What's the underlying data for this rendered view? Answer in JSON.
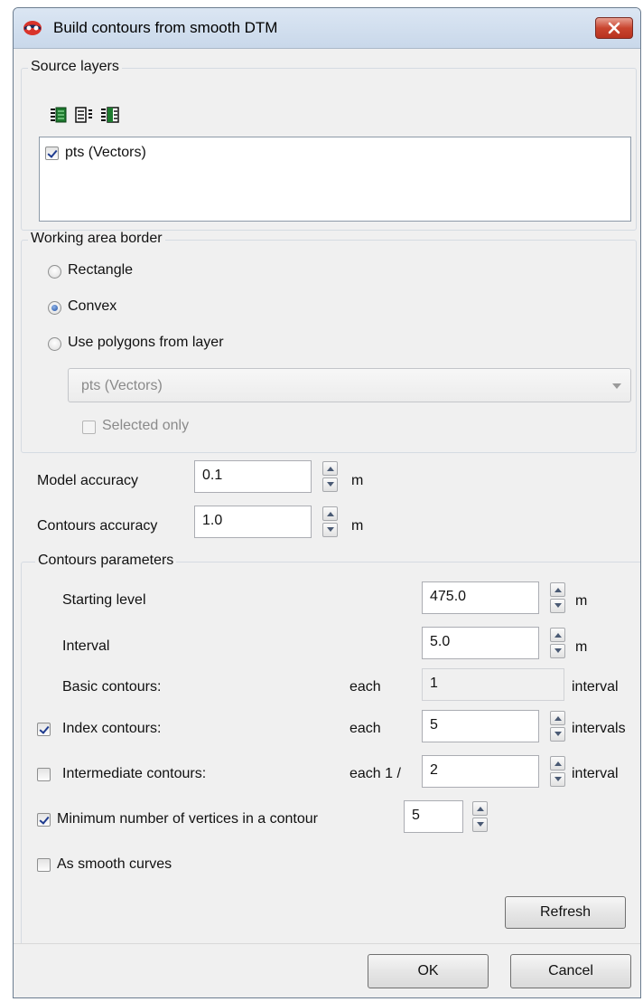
{
  "window": {
    "title": "Build contours from smooth DTM"
  },
  "source_layers": {
    "legend": "Source layers",
    "toolbar_icons": [
      "select-all-icon",
      "deselect-all-icon",
      "invert-selection-icon"
    ],
    "items": [
      {
        "label": "pts (Vectors)",
        "checked": true
      }
    ]
  },
  "working_area": {
    "legend": "Working area border",
    "options": [
      "Rectangle",
      "Convex",
      "Use polygons from layer"
    ],
    "selected": "Convex",
    "layer_combo": "pts (Vectors)",
    "selected_only": "Selected only"
  },
  "model_accuracy": {
    "label": "Model accuracy",
    "value": "0.1",
    "unit": "m"
  },
  "contours_accuracy": {
    "label": "Contours accuracy",
    "value": "1.0",
    "unit": "m"
  },
  "contours_parameters": {
    "legend": "Contours parameters",
    "starting_level": {
      "label": "Starting level",
      "value": "475.0",
      "unit": "m"
    },
    "interval": {
      "label": "Interval",
      "value": "5.0",
      "unit": "m"
    },
    "basic": {
      "label": "Basic contours:",
      "prefix": "each",
      "value": "1",
      "unit": "interval"
    },
    "index": {
      "label": "Index contours:",
      "prefix": "each",
      "value": "5",
      "unit": "intervals",
      "checked": true
    },
    "intermediate": {
      "label": "Intermediate contours:",
      "prefix": "each 1 /",
      "value": "2",
      "unit": "interval",
      "checked": false
    }
  },
  "min_vertices": {
    "label": "Minimum number of vertices in a contour",
    "value": "5",
    "checked": true
  },
  "smooth_curves": {
    "label": "As smooth curves",
    "checked": false
  },
  "buttons": {
    "refresh": "Refresh",
    "ok": "OK",
    "cancel": "Cancel"
  }
}
